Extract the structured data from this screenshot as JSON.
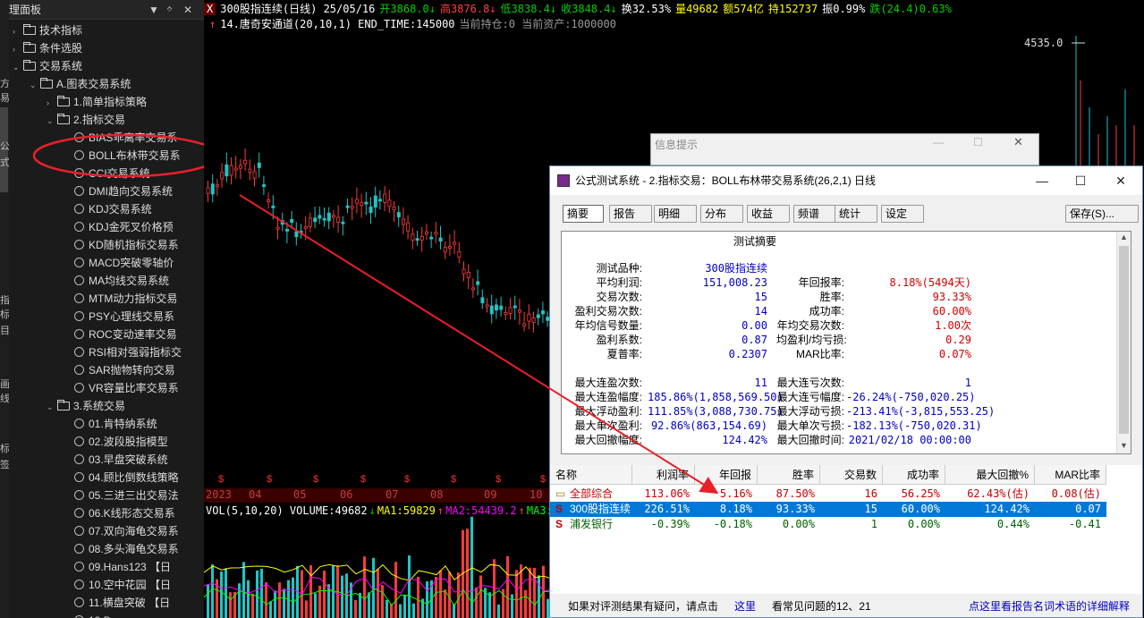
{
  "left_strip": {
    "chars": [
      "方",
      "易",
      "公",
      "式",
      "指",
      "标",
      "目",
      "画",
      "线",
      "标",
      "签"
    ]
  },
  "panel": {
    "title": "理面板",
    "controls": [
      "▼",
      "ᛜ",
      "✕"
    ],
    "tree": [
      {
        "level": 0,
        "exp": "›",
        "icon": "folder",
        "label": "技术指标"
      },
      {
        "level": 0,
        "exp": "›",
        "icon": "folder",
        "label": "条件选股"
      },
      {
        "level": 0,
        "exp": "⌄",
        "icon": "folder",
        "label": "交易系统"
      },
      {
        "level": 1,
        "exp": "⌄",
        "icon": "folder",
        "label": "A.图表交易系统"
      },
      {
        "level": 2,
        "exp": "›",
        "icon": "folder",
        "label": "1.简单指标策略"
      },
      {
        "level": 2,
        "exp": "⌄",
        "icon": "folder",
        "label": "2.指标交易"
      },
      {
        "level": 3,
        "exp": "",
        "icon": "face",
        "label": "BIAS乖离率交易系"
      },
      {
        "level": 3,
        "exp": "",
        "icon": "face",
        "label": "BOLL布林带交易系"
      },
      {
        "level": 3,
        "exp": "",
        "icon": "face",
        "label": "CCI交易系统"
      },
      {
        "level": 3,
        "exp": "",
        "icon": "face",
        "label": "DMI趋向交易系统"
      },
      {
        "level": 3,
        "exp": "",
        "icon": "face",
        "label": "KDJ交易系统"
      },
      {
        "level": 3,
        "exp": "",
        "icon": "face",
        "label": "KDJ金死叉价格预"
      },
      {
        "level": 3,
        "exp": "",
        "icon": "face",
        "label": "KD随机指标交易系"
      },
      {
        "level": 3,
        "exp": "",
        "icon": "face",
        "label": "MACD突破零轴价"
      },
      {
        "level": 3,
        "exp": "",
        "icon": "face",
        "label": "MA均线交易系统"
      },
      {
        "level": 3,
        "exp": "",
        "icon": "face",
        "label": "MTM动力指标交易"
      },
      {
        "level": 3,
        "exp": "",
        "icon": "face",
        "label": "PSY心理线交易系"
      },
      {
        "level": 3,
        "exp": "",
        "icon": "face",
        "label": "ROC变动速率交易"
      },
      {
        "level": 3,
        "exp": "",
        "icon": "face",
        "label": "RSI相对强弱指标交"
      },
      {
        "level": 3,
        "exp": "",
        "icon": "face",
        "label": "SAR抛物转向交易"
      },
      {
        "level": 3,
        "exp": "",
        "icon": "face",
        "label": "VR容量比率交易系"
      },
      {
        "level": 2,
        "exp": "⌄",
        "icon": "folder",
        "label": "3.系统交易"
      },
      {
        "level": 3,
        "exp": "",
        "icon": "face",
        "label": "01.肯特纳系统"
      },
      {
        "level": 3,
        "exp": "",
        "icon": "face",
        "label": "02.波段股指模型"
      },
      {
        "level": 3,
        "exp": "",
        "icon": "face",
        "label": "03.早盘突破系统"
      },
      {
        "level": 3,
        "exp": "",
        "icon": "face",
        "label": "04.顾比倒数线策略"
      },
      {
        "level": 3,
        "exp": "",
        "icon": "face",
        "label": "05.三进三出交易法"
      },
      {
        "level": 3,
        "exp": "",
        "icon": "face",
        "label": "06.K线形态交易系"
      },
      {
        "level": 3,
        "exp": "",
        "icon": "face",
        "label": "07.双向海龟交易系"
      },
      {
        "level": 3,
        "exp": "",
        "icon": "face",
        "label": "08.多头海龟交易系"
      },
      {
        "level": 3,
        "exp": "",
        "icon": "face",
        "label": "09.Hans123 【日"
      },
      {
        "level": 3,
        "exp": "",
        "icon": "face",
        "label": "10.空中花园 【日"
      },
      {
        "level": 3,
        "exp": "",
        "icon": "face",
        "label": "11.横盘突破 【日"
      },
      {
        "level": 3,
        "exp": "",
        "icon": "face",
        "label": "12.D..."
      }
    ]
  },
  "chart": {
    "quote_line": [
      {
        "t": "X",
        "c": "#ffffff"
      },
      {
        "t": "300股指连续(日线) 25/05/16",
        "c": "#ffffff"
      },
      {
        "t": "开3868.0↓",
        "c": "#00d000"
      },
      {
        "t": "高3876.8↓",
        "c": "#ff4040"
      },
      {
        "t": "低3838.4↓",
        "c": "#00d000"
      },
      {
        "t": "收3848.4↓",
        "c": "#00d000"
      },
      {
        "t": "换32.53%",
        "c": "#ffffff"
      },
      {
        "t": "量49682",
        "c": "#ffff00"
      },
      {
        "t": "额574亿",
        "c": "#ffff00"
      },
      {
        "t": "持152737",
        "c": "#ffff00"
      },
      {
        "t": "振0.99%",
        "c": "#ffffff"
      },
      {
        "t": "跌(24.4)0.63%",
        "c": "#00d000"
      }
    ],
    "system_line": [
      {
        "t": "↑",
        "c": "#ff4040"
      },
      {
        "t": "14.唐奇安通道(20,10,1) END_TIME:145000",
        "c": "#ffffff"
      },
      {
        "t": "当前持仓:0 当前资产:1000000",
        "c": "#999999"
      }
    ],
    "price_label": "4535.0",
    "date_axis": [
      "2023",
      "04",
      "05",
      "06",
      "07",
      "08",
      "09",
      "10"
    ],
    "signal_glyph": "$",
    "vol_line": [
      {
        "t": "VOL(5,10,20) VOLUME:49682",
        "c": "#ffffff"
      },
      {
        "t": "↓",
        "c": "#00d000"
      },
      {
        "t": "MA1:59829",
        "c": "#ffff00"
      },
      {
        "t": "↑",
        "c": "#ff4040"
      },
      {
        "t": "MA2:54439.2",
        "c": "#ff00ff"
      },
      {
        "t": "↑",
        "c": "#ff4040"
      },
      {
        "t": "MA3:",
        "c": "#00ff00"
      }
    ]
  },
  "info_dialog": {
    "title": "信息提示"
  },
  "dialog": {
    "title": "公式测试系统 - 2.指标交易：BOLL布林带交易系统(26,2,1) 日线",
    "tabs": [
      "摘要",
      "报告",
      "明细",
      "分布",
      "收益",
      "频谱",
      "统计",
      "设定"
    ],
    "save_label": "保存(S)...",
    "summary_title": "测试摘要",
    "summary_rows": [
      {
        "l1": "测试品种:",
        "v1": "300股指连续",
        "l2": "",
        "v2": ""
      },
      {
        "l1": "平均利润:",
        "v1": "151,008.23",
        "l2": "年回报率:",
        "v2": "8.18%(5494天)"
      },
      {
        "l1": "交易次数:",
        "v1": "15",
        "l2": "胜率:",
        "v2": "93.33%"
      },
      {
        "l1": "盈利交易次数:",
        "v1": "14",
        "l2": "成功率:",
        "v2": "60.00%"
      },
      {
        "l1": "年均信号数量:",
        "v1": "0.00",
        "l2": "年均交易次数:",
        "v2": "1.00次"
      },
      {
        "l1": "盈利系数:",
        "v1": "0.87",
        "l2": "均盈利/均亏损:",
        "v2": "0.29"
      },
      {
        "l1": "夏普率:",
        "v1": "0.2307",
        "l2": "MAR比率:",
        "v2": "0.07%"
      }
    ],
    "summary_rows2": [
      {
        "l1": "最大连盈次数:",
        "v1": "11",
        "l2": "最大连亏次数:",
        "v2": "1"
      },
      {
        "l1": "最大连盈幅度:",
        "v1": "185.86%(1,858,569.50)",
        "l2": "最大连亏幅度:",
        "v2": "-26.24%(-750,020.25)"
      },
      {
        "l1": "最大浮动盈利:",
        "v1": "111.85%(3,088,730.75)",
        "l2": "最大浮动亏损:",
        "v2": "-213.41%(-3,815,553.25)"
      },
      {
        "l1": "最大单次盈利:",
        "v1": "92.86%(863,154.69)",
        "l2": "最大单次亏损:",
        "v2": "-182.13%(-750,020.31)"
      },
      {
        "l1": "最大回撤幅度:",
        "v1": "124.42%",
        "l2": "最大回撤时间:",
        "v2": "2021/02/18 00:00:00"
      }
    ],
    "grid_headers": [
      "名称",
      "利润率",
      "年回报",
      "胜率",
      "交易数",
      "成功率",
      "最大回撤%",
      "MAR比率"
    ],
    "grid_rows": [
      {
        "icon": "folder",
        "name": "全部综合",
        "cells": [
          "113.06%",
          "5.16%",
          "87.50%",
          "16",
          "56.25%",
          "62.43%(估)",
          "0.08(估)"
        ],
        "color": "#c00000",
        "selected": false
      },
      {
        "icon": "S",
        "name": "300股指连续",
        "cells": [
          "226.51%",
          "8.18%",
          "93.33%",
          "15",
          "60.00%",
          "124.42%",
          "0.07"
        ],
        "color": "#ffffff",
        "selected": true
      },
      {
        "icon": "S",
        "name": "浦发银行",
        "cells": [
          "-0.39%",
          "-0.18%",
          "0.00%",
          "1",
          "0.00%",
          "0.44%",
          "-0.41"
        ],
        "color": "#006000",
        "selected": false
      }
    ],
    "footer": {
      "text1": "如果对评测结果有疑问，请点击",
      "link1": "这里",
      "text2": "看常见问题的12、21",
      "link2": "点这里看报告名词术语的详细解释"
    }
  }
}
